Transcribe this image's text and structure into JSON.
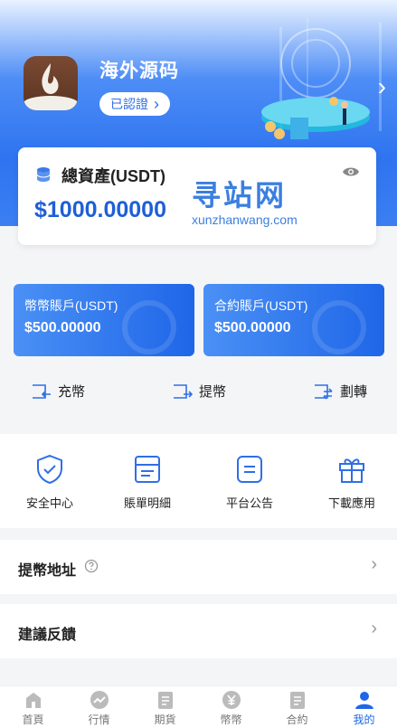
{
  "header": {
    "site_name": "海外源码",
    "verify_label": "已認證",
    "verify_chevron": "›",
    "next_chevron": "›"
  },
  "asset": {
    "title": "總資產(USDT)",
    "value": "$1000.00000"
  },
  "watermark": {
    "cn": "寻站网",
    "en": "xunzhanwang.com"
  },
  "accounts": [
    {
      "label": "幣幣賬戶(USDT)",
      "value": "$500.00000"
    },
    {
      "label": "合約賬戶(USDT)",
      "value": "$500.00000"
    }
  ],
  "actions": [
    {
      "label": "充幣"
    },
    {
      "label": "提幣"
    },
    {
      "label": "劃轉"
    }
  ],
  "grid": [
    {
      "label": "安全中心",
      "icon": "shield-check-icon"
    },
    {
      "label": "賬單明細",
      "icon": "bill-icon"
    },
    {
      "label": "平台公告",
      "icon": "notice-icon"
    },
    {
      "label": "下載應用",
      "icon": "gift-icon"
    }
  ],
  "rows": [
    {
      "label": "提幣地址",
      "chevron": "›"
    },
    {
      "label": "建議反饋",
      "chevron": "›"
    }
  ],
  "tabs": [
    {
      "label": "首頁",
      "icon": "home-icon"
    },
    {
      "label": "行情",
      "icon": "chart-icon"
    },
    {
      "label": "期貨",
      "icon": "doc-icon"
    },
    {
      "label": "幣幣",
      "icon": "coin-icon"
    },
    {
      "label": "合約",
      "icon": "contract-icon"
    },
    {
      "label": "我的",
      "icon": "user-icon"
    }
  ],
  "colors": {
    "primary": "#1f66e8",
    "hero_blue": "#2f74f0"
  }
}
